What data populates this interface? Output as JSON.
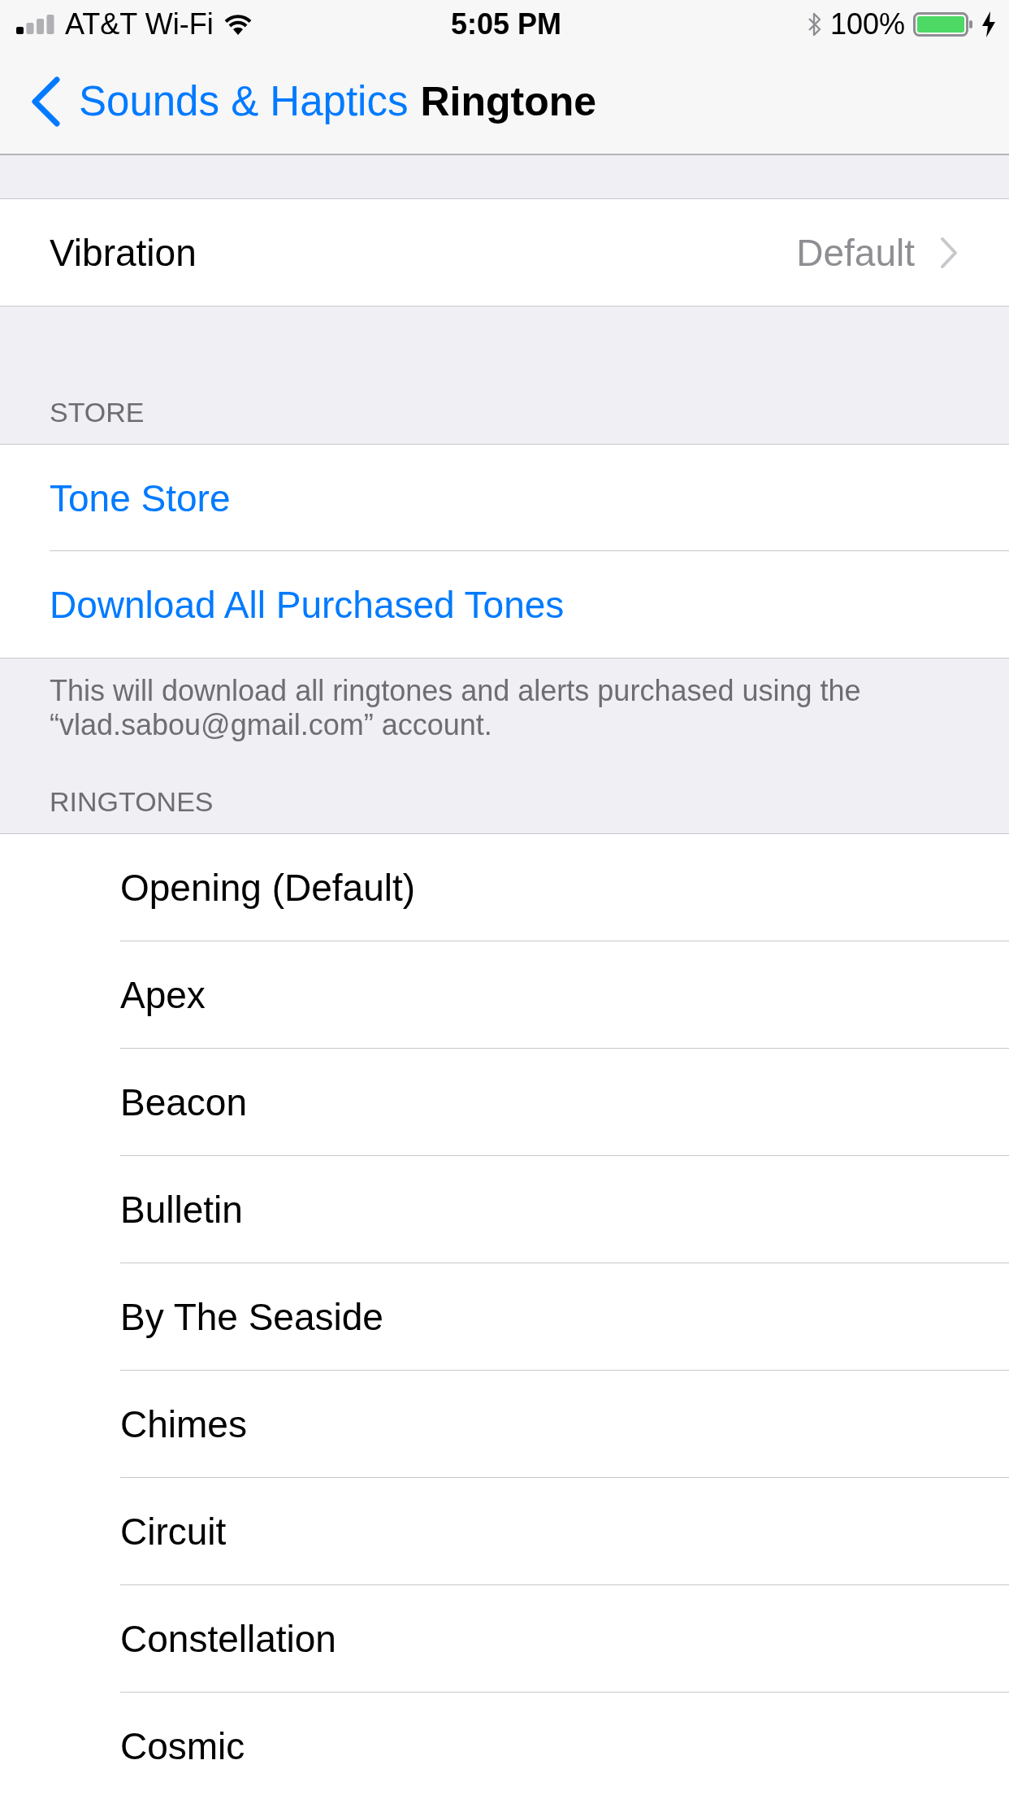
{
  "status_bar": {
    "carrier": "AT&T Wi-Fi",
    "time": "5:05 PM",
    "battery": "100%"
  },
  "nav_bar": {
    "back_label": "Sounds & Haptics",
    "title": "Ringtone"
  },
  "vibration": {
    "label": "Vibration",
    "value": "Default"
  },
  "store": {
    "header": "STORE",
    "items": [
      {
        "label": "Tone Store"
      },
      {
        "label": "Download All Purchased Tones"
      }
    ],
    "footer": "This will download all ringtones and alerts purchased using the “vlad.sabou@gmail.com” account."
  },
  "ringtones": {
    "header": "RINGTONES",
    "items": [
      {
        "label": "Opening (Default)",
        "selected": false
      },
      {
        "label": "Apex",
        "selected": false
      },
      {
        "label": "Beacon",
        "selected": false
      },
      {
        "label": "Bulletin",
        "selected": false
      },
      {
        "label": "By The Seaside",
        "selected": false
      },
      {
        "label": "Chimes",
        "selected": false
      },
      {
        "label": "Circuit",
        "selected": false
      },
      {
        "label": "Constellation",
        "selected": false
      },
      {
        "label": "Cosmic",
        "selected": false
      }
    ]
  }
}
